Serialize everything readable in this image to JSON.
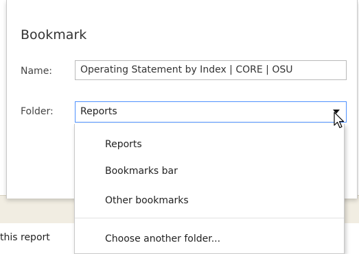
{
  "dialog": {
    "title": "Bookmark",
    "name_label": "Name:",
    "name_value": "Operating Statement by Index | CORE | OSU",
    "folder_label": "Folder:",
    "folder_selected": "Reports"
  },
  "dropdown": {
    "options": [
      "Reports",
      "Bookmarks bar",
      "Other bookmarks"
    ],
    "choose_another": "Choose another folder..."
  },
  "background": {
    "partial_text": "this report"
  },
  "icons": {
    "cursor": "mouse-pointer-icon",
    "arrow": "dropdown-arrow-icon"
  }
}
